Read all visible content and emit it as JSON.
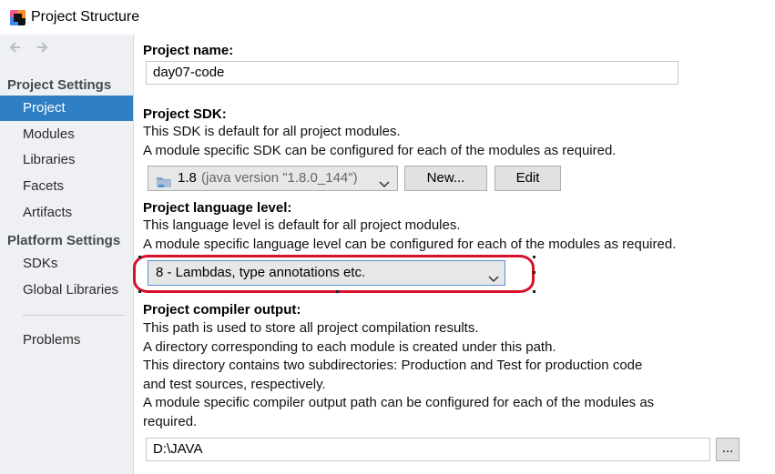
{
  "window": {
    "title": "Project Structure"
  },
  "sidebar": {
    "sections": [
      {
        "title": "Project Settings",
        "items": [
          "Project",
          "Modules",
          "Libraries",
          "Facets",
          "Artifacts"
        ]
      },
      {
        "title": "Platform Settings",
        "items": [
          "SDKs",
          "Global Libraries"
        ]
      }
    ],
    "extra_item": "Problems",
    "selected": "Project"
  },
  "project": {
    "name_label": "Project name:",
    "name_value": "day07-code",
    "sdk": {
      "label": "Project SDK:",
      "desc1": "This SDK is default for all project modules.",
      "desc2": "A module specific SDK can be configured for each of the modules as required.",
      "selected_version": "1.8",
      "selected_detail": "(java version \"1.8.0_144\")",
      "new_button": "New...",
      "edit_button": "Edit"
    },
    "language_level": {
      "label": "Project language level:",
      "desc1": "This language level is default for all project modules.",
      "desc2": "A module specific language level can be configured for each of the modules as required.",
      "selected": "8 - Lambdas, type annotations etc."
    },
    "compiler_output": {
      "label": "Project compiler output:",
      "lines": [
        "This path is used to store all project compilation results.",
        "A directory corresponding to each module is created under this path.",
        "This directory contains two subdirectories: Production and Test for production code",
        "and test sources, respectively.",
        "A module specific compiler output path can be configured for each of the modules as",
        "required."
      ],
      "path_value": "D:\\JAVA",
      "browse_button": "..."
    }
  },
  "colors": {
    "selection": "#2f7fc5",
    "highlight_outline": "#d8112b",
    "sidebar_bg": "#eef0f3"
  },
  "icons": {
    "back": "arrow-left-icon",
    "forward": "arrow-right-icon",
    "app": "intellij-icon",
    "sdk": "folder-icon"
  }
}
